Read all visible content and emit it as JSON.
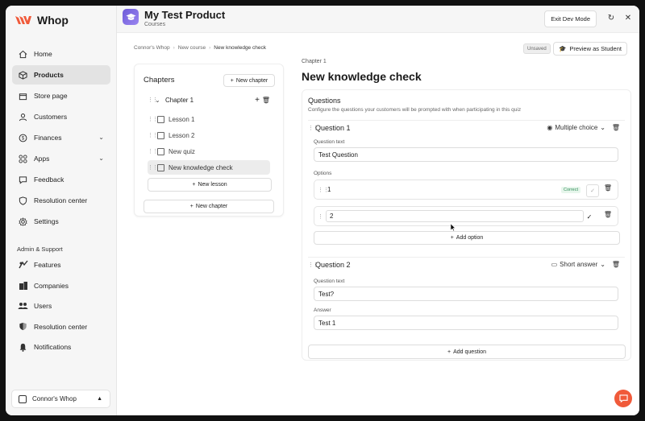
{
  "brand": {
    "name": "Whop",
    "accent": "#f05a3a"
  },
  "sidebar": {
    "items": [
      {
        "label": "Home",
        "icon": "home-icon"
      },
      {
        "label": "Products",
        "icon": "box-icon",
        "active": true
      },
      {
        "label": "Store page",
        "icon": "store-icon"
      },
      {
        "label": "Customers",
        "icon": "user-icon"
      },
      {
        "label": "Finances",
        "icon": "dollar-icon",
        "chevron": true
      },
      {
        "label": "Apps",
        "icon": "apps-icon",
        "chevron": true
      },
      {
        "label": "Feedback",
        "icon": "feedback-icon"
      },
      {
        "label": "Resolution center",
        "icon": "shield-icon"
      },
      {
        "label": "Settings",
        "icon": "gear-icon"
      }
    ],
    "section_label": "Admin & Support",
    "admin_items": [
      {
        "label": "Features",
        "icon": "features-icon"
      },
      {
        "label": "Companies",
        "icon": "building-icon"
      },
      {
        "label": "Users",
        "icon": "users-icon"
      },
      {
        "label": "Resolution center",
        "icon": "shield-icon"
      },
      {
        "label": "Notifications",
        "icon": "bell-icon"
      }
    ],
    "workspace": "Connor's Whop"
  },
  "topbar": {
    "title": "My Test Product",
    "subtitle": "Courses",
    "exit_label": "Exit Dev Mode"
  },
  "breadcrumb": [
    "Connor's Whop",
    "New course",
    "New knowledge check"
  ],
  "status": {
    "unsaved": "Unsaved",
    "preview_label": "Preview as Student"
  },
  "chapters": {
    "title": "Chapters",
    "new_chapter_label": "New chapter",
    "chapter_name": "Chapter 1",
    "lessons": [
      "Lesson 1",
      "Lesson 2",
      "New quiz",
      "New knowledge check"
    ],
    "new_lesson_label": "New lesson",
    "new_chapter_bottom_label": "New chapter"
  },
  "editor": {
    "chapter_label": "Chapter 1",
    "title": "New knowledge check",
    "questions_heading": "Questions",
    "questions_desc": "Configure the questions your customers will be prompted with when participating in this quiz",
    "q1": {
      "name": "Question 1",
      "type": "Multiple choice",
      "text_label": "Question text",
      "text_value": "Test Question",
      "options_label": "Options",
      "options": [
        "1",
        "2"
      ],
      "correct_badge": "Correct",
      "add_option_label": "Add option"
    },
    "q2": {
      "name": "Question 2",
      "type": "Short answer",
      "text_label": "Question text",
      "text_value": "Test?",
      "answer_label": "Answer",
      "answer_value": "Test 1"
    },
    "add_question_label": "Add question"
  }
}
